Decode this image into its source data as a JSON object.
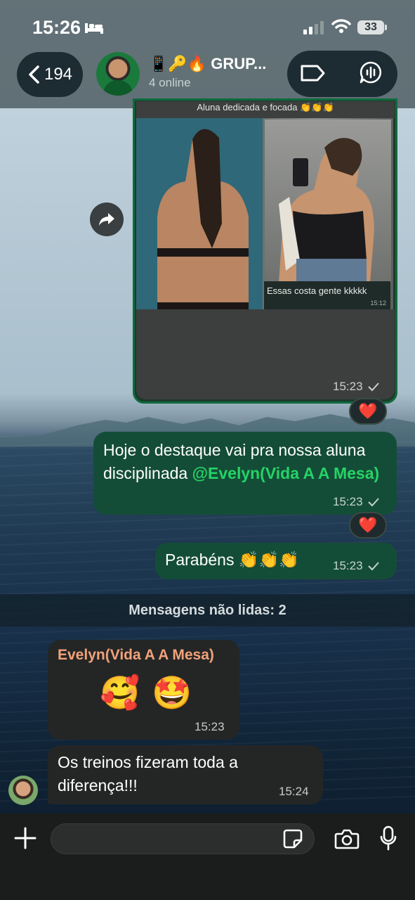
{
  "status": {
    "time": "15:26",
    "battery": "33"
  },
  "header": {
    "back_count": "194",
    "group_name": "📱🔑🔥 GRUP...",
    "online": "4 online"
  },
  "messages": {
    "media": {
      "header_text": "Aluna dedicada e focada 👏👏👏",
      "caption": "Essas costa gente kkkkk",
      "caption_time": "15:12",
      "time": "15:23",
      "reaction": "❤️"
    },
    "highlight": {
      "text_before": "Hoje o destaque vai pra nossa aluna disciplinada ",
      "mention": "@Evelyn(Vida A A Mesa)",
      "time": "15:23",
      "reaction": "❤️"
    },
    "congrats": {
      "text": "Parabéns 👏👏👏",
      "time": "15:23"
    },
    "unread_label": "Mensagens não lidas: 2",
    "incoming1": {
      "sender": "Evelyn(Vida A A Mesa)",
      "emoji": "🥰 🤩",
      "time": "15:23"
    },
    "incoming2": {
      "text": "Os treinos fizeram toda a diferença!!!",
      "time": "15:24"
    }
  },
  "composer": {
    "placeholder": ""
  },
  "colors": {
    "outgoing": "#144d37",
    "incoming": "#242626",
    "mention": "#25d366",
    "sender": "#f2a27a"
  }
}
